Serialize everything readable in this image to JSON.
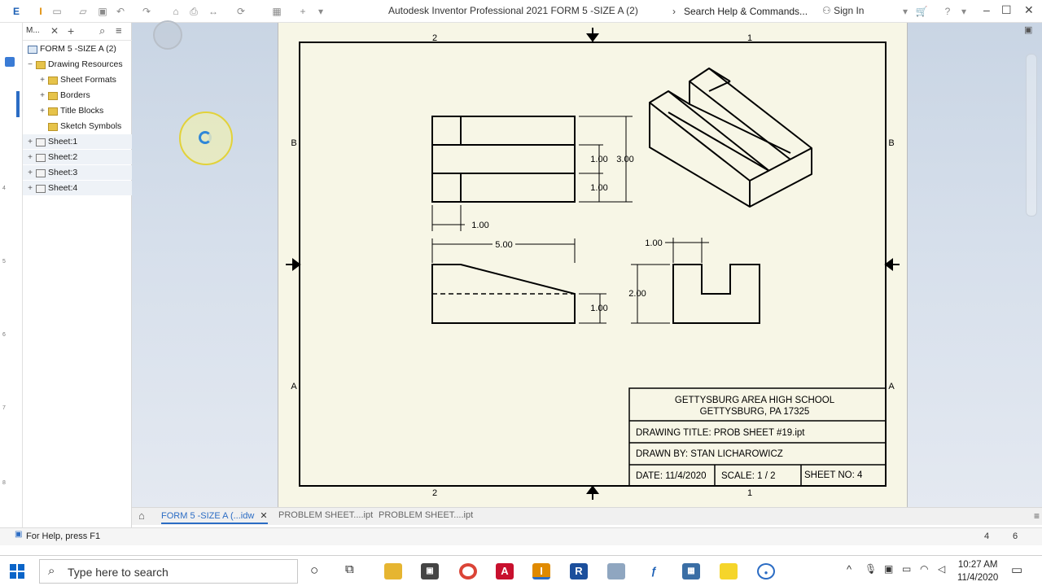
{
  "window": {
    "title": "Autodesk Inventor Professional 2021    FORM 5 -SIZE A (2)",
    "search_placeholder": "Search Help & Commands...",
    "sign_in": "Sign In",
    "app_letter": "I"
  },
  "browser": {
    "tab_label": "M...",
    "root": "FORM 5 -SIZE A (2)",
    "drawing_resources": "Drawing Resources",
    "items": [
      {
        "label": "Sheet Formats"
      },
      {
        "label": "Borders"
      },
      {
        "label": "Title Blocks"
      },
      {
        "label": "Sketch Symbols"
      }
    ],
    "sheets": [
      {
        "label": "Sheet:1"
      },
      {
        "label": "Sheet:2"
      },
      {
        "label": "Sheet:3"
      },
      {
        "label": "Sheet:4"
      }
    ]
  },
  "drawing": {
    "zone_top_left": "2",
    "zone_top_right": "1",
    "zone_bottom_left": "2",
    "zone_bottom_right": "1",
    "zone_b": "B",
    "zone_a": "A",
    "dims": {
      "d_top_1": "1.00",
      "d_top_2": "1.00",
      "d_top_overall": "3.00",
      "d_front_left": "1.00",
      "d_front_width": "5.00",
      "d_front_right": "1.00",
      "d_side_top": "1.00",
      "d_side_height": "2.00"
    },
    "title_block": {
      "school": "GETTYSBURG AREA HIGH SCHOOL",
      "address": "GETTYSBURG, PA 17325",
      "drawing_title": "DRAWING TITLE:  PROB SHEET #19.ipt",
      "drawn_by": "DRAWN BY: STAN LICHAROWICZ",
      "date": "DATE: 11/4/2020",
      "scale": "SCALE: 1 / 2",
      "sheet_no": "SHEET NO: 4"
    }
  },
  "doc_tabs": [
    {
      "label": "FORM 5 -SIZE A (...idw",
      "active": true
    },
    {
      "label": "PROBLEM SHEET....ipt",
      "active": false
    },
    {
      "label": "PROBLEM SHEET....ipt",
      "active": false
    }
  ],
  "status": {
    "help": "For Help, press F1",
    "num_a": "4",
    "num_b": "6"
  },
  "taskbar": {
    "search_placeholder": "Type here to search",
    "time": "10:27 AM",
    "date": "11/4/2020"
  },
  "ruler": [
    "4",
    "5",
    "6",
    "7",
    "8"
  ],
  "colors": {
    "sheet_bg": "#f7f6e6",
    "canvas_bg": "#d3dcea",
    "accent": "#2b6cc4"
  }
}
